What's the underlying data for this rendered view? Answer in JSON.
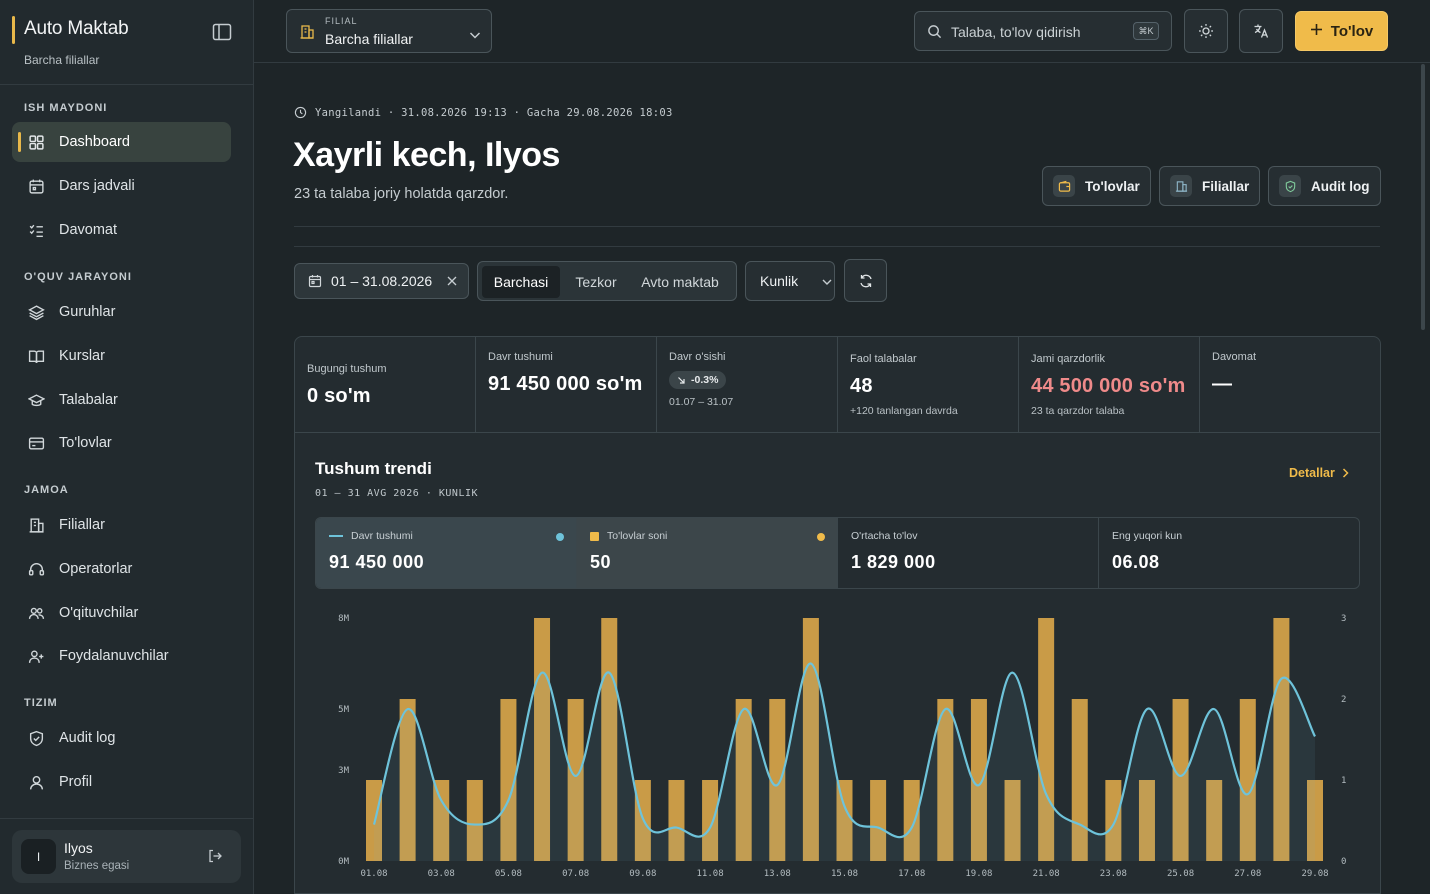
{
  "sidebar": {
    "title": "Auto Maktab",
    "subtitle": "Barcha filiallar",
    "sections": [
      {
        "label": "ISH MAYDONI",
        "items": [
          {
            "label": "Dashboard",
            "icon": "grid-icon",
            "active": true
          },
          {
            "label": "Dars jadvali",
            "icon": "calendar-icon"
          },
          {
            "label": "Davomat",
            "icon": "checklist-icon"
          }
        ]
      },
      {
        "label": "O'QUV JARAYONI",
        "items": [
          {
            "label": "Guruhlar",
            "icon": "layers-icon"
          },
          {
            "label": "Kurslar",
            "icon": "book-icon"
          },
          {
            "label": "Talabalar",
            "icon": "graduation-cap-icon"
          },
          {
            "label": "To'lovlar",
            "icon": "credit-card-icon"
          }
        ]
      },
      {
        "label": "JAMOA",
        "items": [
          {
            "label": "Filiallar",
            "icon": "building-icon"
          },
          {
            "label": "Operatorlar",
            "icon": "headset-icon"
          },
          {
            "label": "O'qituvchilar",
            "icon": "users-icon"
          },
          {
            "label": "Foydalanuvchilar",
            "icon": "user-plus-icon"
          }
        ]
      },
      {
        "label": "TIZIM",
        "items": [
          {
            "label": "Audit log",
            "icon": "shield-icon"
          },
          {
            "label": "Profil",
            "icon": "user-icon"
          }
        ]
      }
    ],
    "user": {
      "initial": "I",
      "name": "Ilyos",
      "role": "Biznes egasi"
    }
  },
  "topbar": {
    "branch_label": "FILIAL",
    "branch_value": "Barcha filiallar",
    "search_placeholder": "Talaba, to'lov qidirish",
    "search_shortcut": "⌘K",
    "primary_button": "To'lov"
  },
  "header": {
    "updated": "Yangilandi · 31.08.2026 19:13 · Gacha 29.08.2026 18:03",
    "greeting": "Xayrli kech, Ilyos",
    "subtext": "23 ta talaba joriy holatda qarzdor.",
    "quick_actions": [
      "To'lovlar",
      "Filiallar",
      "Audit log"
    ]
  },
  "filters": {
    "date_range": "01 – 31.08.2026",
    "segments": [
      "Barchasi",
      "Tezkor",
      "Avto maktab"
    ],
    "active_segment": "Barchasi",
    "period": "Kunlik"
  },
  "kpis": [
    {
      "label": "Bugungi tushum",
      "value": "0 so'm"
    },
    {
      "label": "Davr tushumi",
      "value": "91 450 000 so'm"
    },
    {
      "label": "Davr o'sishi",
      "delta": "-0.3%",
      "note": "01.07 – 31.07"
    },
    {
      "label": "Faol talabalar",
      "value": "48",
      "note": "+120 tanlangan davrda"
    },
    {
      "label": "Jami qarzdorlik",
      "value": "44 500 000 so'm",
      "note": "23 ta qarzdor talaba"
    },
    {
      "label": "Davomat",
      "value": "—"
    }
  ],
  "trend": {
    "title": "Tushum trendi",
    "subtitle": "01 – 31 AVG 2026 · KUNLIK",
    "details": "Detallar",
    "cards": [
      {
        "label": "Davr tushumi",
        "value": "91 450 000"
      },
      {
        "label": "To'lovlar soni",
        "value": "50"
      },
      {
        "label": "O'rtacha to'lov",
        "value": "1 829 000"
      },
      {
        "label": "Eng yuqori kun",
        "value": "06.08"
      }
    ]
  },
  "colors": {
    "accent": "#f0bb4a",
    "line": "#6ec3da",
    "danger": "#ef8a8a"
  },
  "chart_data": {
    "type": "bar",
    "categories": [
      "01.08",
      "02.08",
      "03.08",
      "04.08",
      "05.08",
      "06.08",
      "07.08",
      "08.08",
      "09.08",
      "10.08",
      "11.08",
      "12.08",
      "13.08",
      "14.08",
      "15.08",
      "16.08",
      "17.08",
      "18.08",
      "19.08",
      "20.08",
      "21.08",
      "22.08",
      "23.08",
      "24.08",
      "25.08",
      "26.08",
      "27.08",
      "28.08",
      "29.08"
    ],
    "x_tick_labels": [
      "01.08",
      "03.08",
      "05.08",
      "07.08",
      "09.08",
      "11.08",
      "13.08",
      "15.08",
      "17.08",
      "19.08",
      "21.08",
      "23.08",
      "25.08",
      "27.08",
      "29.08"
    ],
    "series": [
      {
        "name": "To'lovlar soni",
        "axis": "right",
        "render": "bar",
        "values": [
          1,
          2,
          1,
          1,
          2,
          3,
          2,
          3,
          1,
          1,
          1,
          2,
          2,
          3,
          1,
          1,
          1,
          2,
          2,
          1,
          3,
          2,
          1,
          1,
          2,
          1,
          2,
          3,
          1
        ]
      },
      {
        "name": "Davr tushumi",
        "axis": "left",
        "render": "line",
        "values": [
          1200000,
          5000000,
          2000000,
          1200000,
          2000000,
          6200000,
          2800000,
          6200000,
          1400000,
          1100000,
          1100000,
          5000000,
          2500000,
          6500000,
          1800000,
          1100000,
          1100000,
          5000000,
          2500000,
          6200000,
          2200000,
          1200000,
          1200000,
          5000000,
          2800000,
          5000000,
          2200000,
          6000000,
          4100000
        ]
      }
    ],
    "y_left_ticks": [
      "0M",
      "3M",
      "5M",
      "8M"
    ],
    "y_left_lim": [
      0,
      8000000
    ],
    "y_right_ticks": [
      "0",
      "1",
      "2",
      "3"
    ],
    "y_right_lim": [
      0,
      3
    ],
    "grid": false,
    "legend": "none"
  }
}
